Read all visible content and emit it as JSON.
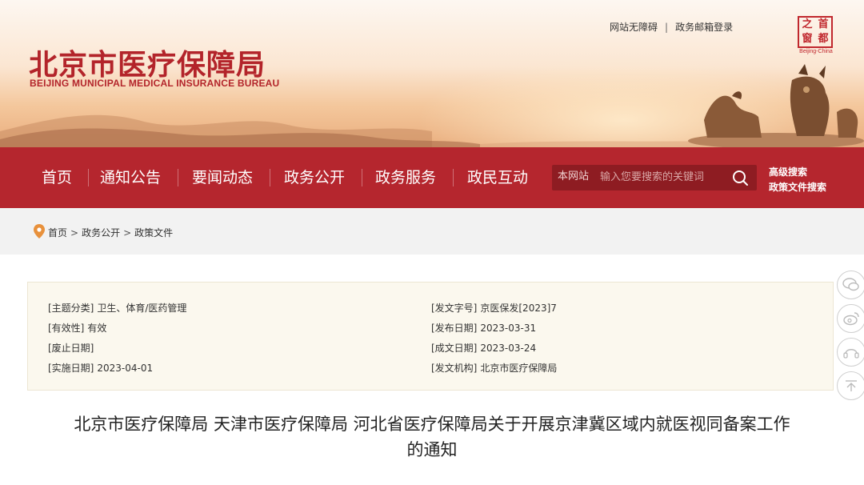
{
  "header": {
    "title_cn": "北京市医疗保障局",
    "title_en": "BEIJING MUNICIPAL MEDICAL INSURANCE BUREAU",
    "top_links": [
      "网站无障碍",
      "政务邮箱登录"
    ],
    "top_links_sep": "|",
    "seal_chars": [
      "之",
      "首",
      "窗",
      "都"
    ],
    "seal_caption": "Beijing-China"
  },
  "nav": {
    "items": [
      "首页",
      "通知公告",
      "要闻动态",
      "政务公开",
      "政务服务",
      "政民互动"
    ],
    "search_scope": "本网站",
    "search_placeholder": "输入您要搜索的关键词",
    "advanced_search": "高级搜索",
    "policy_search": "政策文件搜索"
  },
  "breadcrumb": {
    "items": [
      "首页",
      "政务公开",
      "政策文件"
    ],
    "sep": ">"
  },
  "info": {
    "left": [
      {
        "key": "[主题分类]",
        "value": "卫生、体育/医药管理"
      },
      {
        "key": "[有效性]",
        "value": "有效"
      },
      {
        "key": "[废止日期]",
        "value": ""
      },
      {
        "key": "[实施日期]",
        "value": "2023-04-01"
      }
    ],
    "right": [
      {
        "key": "[发文字号]",
        "value": "京医保发[2023]7"
      },
      {
        "key": "[发布日期]",
        "value": "2023-03-31"
      },
      {
        "key": "[成文日期]",
        "value": "2023-03-24"
      },
      {
        "key": "[发文机构]",
        "value": "北京市医疗保障局"
      }
    ]
  },
  "doc": {
    "title_line1": "北京市医疗保障局 天津市医疗保障局 河北省医疗保障局关于开展京津冀区域内就医视同备案工作",
    "title_line2": "的通知"
  },
  "share_icons": [
    "wechat-icon",
    "weibo-icon",
    "headset-icon",
    "back-to-top-icon"
  ],
  "colors": {
    "brand_red": "#b5262e",
    "search_bg": "#8e1c22",
    "info_bg": "#fbf8ee",
    "crumb_bg": "#f2f2f2",
    "pin_orange": "#e8913c"
  }
}
